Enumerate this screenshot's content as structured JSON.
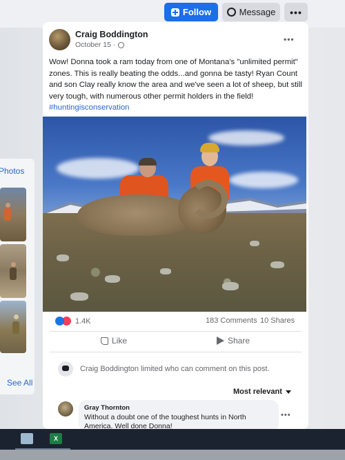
{
  "header": {
    "follow_label": "Follow",
    "message_label": "Message",
    "more_label": "•••"
  },
  "sidebar": {
    "title": "Photos",
    "see_all": "See All"
  },
  "post": {
    "author": "Craig Boddington",
    "date": "October 15 ·",
    "more_label": "•••",
    "text": "Wow! Donna took a ram today from one of Montana's \"unlimited permit\" zones. This is really beating the odds...and gonna be tasty! Ryan Count and son Clay really know the area and we've seen a lot of sheep, but still very tough, with numerous other permit holders in the field!",
    "hashtag": "#huntingisconservation",
    "reaction_count": "1.4K",
    "comments_count": "183 Comments",
    "shares_count": "10 Shares",
    "like_label": "Like",
    "share_label": "Share",
    "limit_notice": "Craig Boddington limited who can comment on this post.",
    "sort_label": "Most relevant"
  },
  "comment": {
    "author": "Gray Thornton",
    "text": "Without a doubt one of the toughest hunts in North America. Well done Donna!",
    "more_label": "•••"
  },
  "taskbar": {
    "excel_label": "X"
  },
  "colors": {
    "accent": "#1b6fe8",
    "link": "#2a67c9",
    "text": "#1c1e21",
    "muted": "#65676b"
  }
}
